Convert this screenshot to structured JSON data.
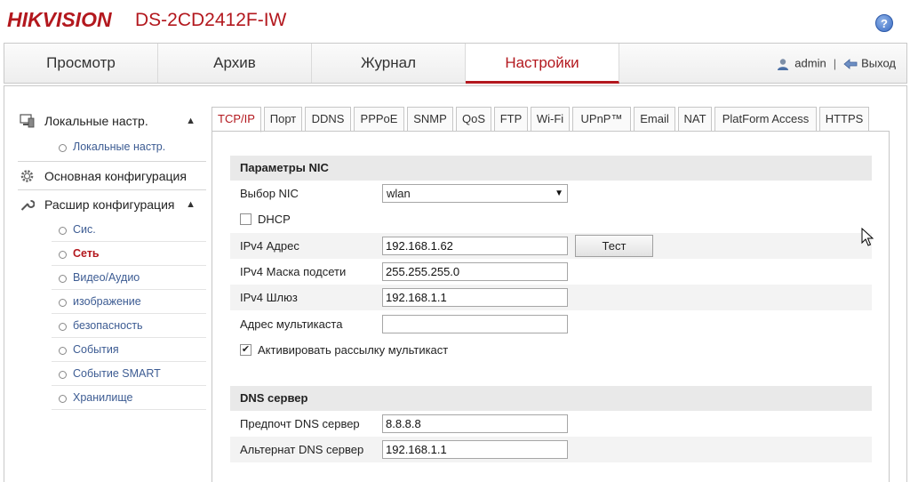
{
  "brand": "HIKVISION",
  "model": "DS-2CD2412F-IW",
  "help_label": "?",
  "nav": {
    "items": [
      "Просмотр",
      "Архив",
      "Журнал",
      "Настройки"
    ],
    "active": "Настройки",
    "user": "admin",
    "separator": "|",
    "logout": "Выход"
  },
  "sidebar": {
    "local": {
      "label": "Локальные настр.",
      "chevron": "▲",
      "items": [
        "Локальные настр."
      ]
    },
    "basic": {
      "label": "Основная конфигурация"
    },
    "advanced": {
      "label": "Расшир конфигурация",
      "chevron": "▲",
      "items": [
        "Сис.",
        "Сеть",
        "Видео/Аудио",
        "изображение",
        "безопасность",
        "События",
        "Событие SMART",
        "Хранилище"
      ],
      "active": "Сеть"
    }
  },
  "tabs": [
    "TCP/IP",
    "Порт",
    "DDNS",
    "PPPoE",
    "SNMP",
    "QoS",
    "FTP",
    "Wi-Fi",
    "UPnP™",
    "Email",
    "NAT",
    "PlatForm Access",
    "HTTPS"
  ],
  "active_tab": "TCP/IP",
  "nic": {
    "header": "Параметры NIC",
    "nic_label": "Выбор NIC",
    "nic_value": "wlan",
    "dhcp_label": "DHCP",
    "dhcp_checked": false,
    "ipv4_label": "IPv4 Адрес",
    "ipv4_value": "192.168.1.62",
    "test_button": "Тест",
    "mask_label": "IPv4 Маска подсети",
    "mask_value": "255.255.255.0",
    "gateway_label": "IPv4 Шлюз",
    "gateway_value": "192.168.1.1",
    "multicast_label": "Адрес мультикаста",
    "multicast_value": "",
    "multicast_enable_label": "Активировать рассылку мультикаст",
    "multicast_enable_checked": true
  },
  "dns": {
    "header": "DNS сервер",
    "preferred_label": "Предпочт DNS сервер",
    "preferred_value": "8.8.8.8",
    "alternate_label": "Альтернат DNS сервер",
    "alternate_value": "192.168.1.1"
  },
  "colors": {
    "accent": "#b3181e",
    "link": "#3d5c93",
    "group_bg": "#e9e9e9"
  }
}
